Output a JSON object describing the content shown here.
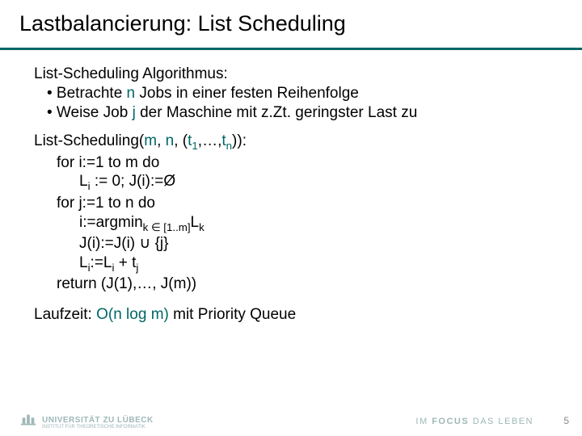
{
  "title": "Lastbalancierung: List Scheduling",
  "section1": {
    "heading": "List-Scheduling Algorithmus:",
    "bullet1_pre": "•  Betrachte ",
    "bullet1_var": "n",
    "bullet1_post": " Jobs in einer festen Reihenfolge",
    "bullet2_pre": "•  Weise Job ",
    "bullet2_var": "j",
    "bullet2_post": " der Maschine mit z.Zt. geringster Last zu"
  },
  "pseudo": {
    "sig_pre": "List-Scheduling(",
    "sig_m": "m",
    "sig_c1": ", ",
    "sig_n": "n",
    "sig_c2": ", (",
    "sig_t1": "t",
    "sig_t1sub": "1",
    "sig_mid": ",…,",
    "sig_tn": "t",
    "sig_tnsub": "n",
    "sig_post": ")):",
    "l1": "for i:=1 to m do",
    "l2_a": "L",
    "l2_asub": "i",
    "l2_b": " := 0; J(i):=Ø",
    "l3": "for j:=1 to n do",
    "l4_a": "i:=argmin",
    "l4_sub": "k ∈ [1..m]",
    "l4_b": "L",
    "l4_bsub": "k",
    "l5": "J(i):=J(i) ∪ {j}",
    "l6_a": "L",
    "l6_asub": "i",
    "l6_b": ":=L",
    "l6_bsub": "i",
    "l6_c": " + t",
    "l6_csub": "j",
    "l7": "return (J(1),…, J(m))"
  },
  "runtime": {
    "pre": "Laufzeit: ",
    "complexity": "O(n log m)",
    "post": " mit Priority Queue"
  },
  "footer": {
    "uni_name": "UNIVERSITÄT ZU LÜBECK",
    "uni_sub": "INSTITUT FÜR THEORETISCHE INFORMATIK",
    "motto_a": "IM ",
    "motto_b": "FOCUS",
    "motto_c": " DAS LEBEN",
    "page": "5"
  }
}
